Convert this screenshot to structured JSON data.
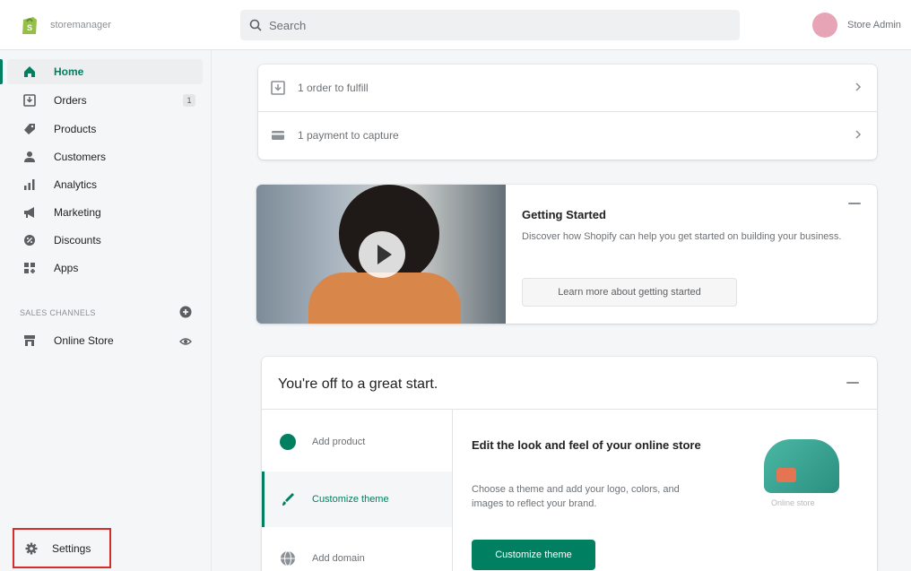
{
  "header": {
    "store_name": "storemanager",
    "search_placeholder": "Search",
    "account_name": "Store Admin",
    "accent": "#008060"
  },
  "sidebar": {
    "items": [
      {
        "label": "Home",
        "icon": "home-icon",
        "badge": ""
      },
      {
        "label": "Orders",
        "icon": "orders-icon",
        "badge": "1"
      },
      {
        "label": "Products",
        "icon": "tag-icon",
        "badge": ""
      },
      {
        "label": "Customers",
        "icon": "person-icon",
        "badge": ""
      },
      {
        "label": "Analytics",
        "icon": "bar-chart-icon",
        "badge": ""
      },
      {
        "label": "Marketing",
        "icon": "megaphone-icon",
        "badge": ""
      },
      {
        "label": "Discounts",
        "icon": "discount-icon",
        "badge": ""
      },
      {
        "label": "Apps",
        "icon": "apps-icon",
        "badge": ""
      }
    ],
    "sales_channels_title": "SALES CHANNELS",
    "channels": [
      {
        "label": "Online Store",
        "icon": "store-icon"
      }
    ],
    "settings_label": "Settings",
    "highlight_color": "#d72c2c"
  },
  "tasks": {
    "orders_to_fulfill": "1 order to fulfill",
    "payment_capture": "1 payment to capture"
  },
  "getting_started": {
    "title": "Getting Started",
    "description": "Discover how Shopify can help you get started on building your business.",
    "button": "Learn more about getting started"
  },
  "setup": {
    "title": "You're off to a great start.",
    "steps": [
      {
        "label": "Add product"
      },
      {
        "label": "Customize theme"
      },
      {
        "label": "Add domain"
      }
    ],
    "active_heading": "Edit the look and feel of your online store",
    "active_text": "Choose a theme and add your logo, colors, and images to reflect your brand.",
    "primary_button": "Customize theme",
    "illustration_caption": "Online store"
  }
}
